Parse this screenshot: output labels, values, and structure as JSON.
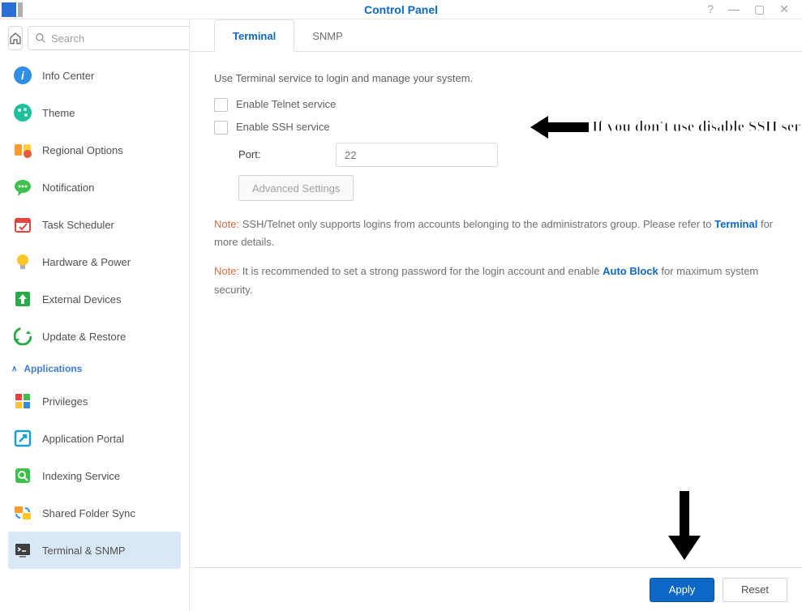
{
  "window": {
    "title": "Control Panel",
    "search_placeholder": "Search"
  },
  "sidebar": {
    "items": [
      {
        "label": "Info Center"
      },
      {
        "label": "Theme"
      },
      {
        "label": "Regional Options"
      },
      {
        "label": "Notification"
      },
      {
        "label": "Task Scheduler"
      },
      {
        "label": "Hardware & Power"
      },
      {
        "label": "External Devices"
      },
      {
        "label": "Update & Restore"
      }
    ],
    "group_label": "Applications",
    "app_items": [
      {
        "label": "Privileges"
      },
      {
        "label": "Application Portal"
      },
      {
        "label": "Indexing Service"
      },
      {
        "label": "Shared Folder Sync"
      },
      {
        "label": "Terminal & SNMP"
      }
    ]
  },
  "tabs": {
    "terminal": "Terminal",
    "snmp": "SNMP"
  },
  "terminal": {
    "description": "Use Terminal service to login and manage your system.",
    "enable_telnet": "Enable Telnet service",
    "enable_ssh": "Enable SSH service",
    "port_label": "Port:",
    "port_value": "22",
    "advanced_btn": "Advanced Settings",
    "note1_label": "Note:",
    "note1_text_a": " SSH/Telnet only supports logins from accounts belonging to the administrators group. Please refer to ",
    "note1_link": "Terminal",
    "note1_text_b": " for more details.",
    "note2_label": "Note:",
    "note2_text_a": " It is recommended to set a strong password for the login account and enable ",
    "note2_link": "Auto Block",
    "note2_text_b": " for maximum system security."
  },
  "footer": {
    "apply": "Apply",
    "reset": "Reset"
  },
  "annotation": {
    "ssh_tip": "If you don't use disable SSH service"
  }
}
